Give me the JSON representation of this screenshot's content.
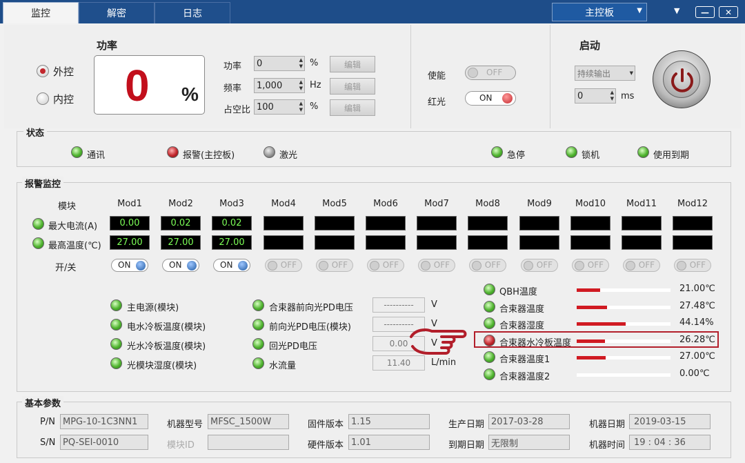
{
  "tabs": [
    {
      "label": "监控"
    },
    {
      "label": "解密"
    },
    {
      "label": "日志"
    }
  ],
  "board_select": "主控板",
  "control": {
    "external": "外控",
    "internal": "内控",
    "selected": "external"
  },
  "power": {
    "title": "功率",
    "value": "0",
    "unit": "%"
  },
  "params": [
    {
      "label": "功率",
      "value": "0",
      "unit": "%",
      "edit": "编辑"
    },
    {
      "label": "频率",
      "value": "1,000",
      "unit": "Hz",
      "edit": "编辑"
    },
    {
      "label": "占空比",
      "value": "100",
      "unit": "%",
      "edit": "编辑"
    }
  ],
  "enable": {
    "label": "使能",
    "state": "OFF"
  },
  "redlight": {
    "label": "红光",
    "state": "ON"
  },
  "start": {
    "title": "启动",
    "mode": "持续输出",
    "ms_value": "0",
    "ms_unit": "ms"
  },
  "status": {
    "title": "状态",
    "items": [
      {
        "label": "通讯",
        "color": "green"
      },
      {
        "label": "报警(主控板)",
        "color": "red"
      },
      {
        "label": "激光",
        "color": "gray"
      },
      {
        "label": "急停",
        "color": "green"
      },
      {
        "label": "锁机",
        "color": "green"
      },
      {
        "label": "使用到期",
        "color": "green"
      }
    ]
  },
  "alarm": {
    "title": "报警监控",
    "module_label": "模块",
    "modules": [
      "Mod1",
      "Mod2",
      "Mod3",
      "Mod4",
      "Mod5",
      "Mod6",
      "Mod7",
      "Mod8",
      "Mod9",
      "Mod10",
      "Mod11",
      "Mod12"
    ],
    "max_current_label": "最大电流(A)",
    "max_temp_label": "最高温度(℃)",
    "max_current": [
      "0.00",
      "0.02",
      "0.02",
      "",
      "",
      "",
      "",
      "",
      "",
      "",
      "",
      ""
    ],
    "max_temp": [
      "27.00",
      "27.00",
      "27.00",
      "",
      "",
      "",
      "",
      "",
      "",
      "",
      "",
      ""
    ],
    "switch_label": "开/关",
    "switches": [
      "ON",
      "ON",
      "ON",
      "OFF",
      "OFF",
      "OFF",
      "OFF",
      "OFF",
      "OFF",
      "OFF",
      "OFF",
      "OFF"
    ]
  },
  "checks_left": [
    "主电源(模块)",
    "电水冷板温度(模块)",
    "光水冷板温度(模块)",
    "光模块湿度(模块)"
  ],
  "checks_mid": [
    {
      "label": "合束器前向光PD电压",
      "value": "----------",
      "unit": "V"
    },
    {
      "label": "前向光PD电压(模块)",
      "value": "----------",
      "unit": "V"
    },
    {
      "label": "回光PD电压",
      "value": "0.00",
      "unit": "V"
    },
    {
      "label": "水流量",
      "value": "11.40",
      "unit": "L/min"
    }
  ],
  "sensors": [
    {
      "label": "QBH温度",
      "value": "21.00℃",
      "level": 0.25,
      "color": "green"
    },
    {
      "label": "合束器温度",
      "value": "27.48℃",
      "level": 0.32,
      "color": "green"
    },
    {
      "label": "合束器湿度",
      "value": "44.14%",
      "level": 0.52,
      "color": "green"
    },
    {
      "label": "合束器水冷板温度",
      "value": "26.28℃",
      "level": 0.3,
      "color": "red"
    },
    {
      "label": "合束器温度1",
      "value": "27.00℃",
      "level": 0.31,
      "color": "green"
    },
    {
      "label": "合束器温度2",
      "value": "0.00℃",
      "level": 0.0,
      "color": "green"
    }
  ],
  "basic": {
    "title": "基本参数",
    "pn_label": "P/N",
    "pn": "MPG-10-1C3NN1",
    "sn_label": "S/N",
    "sn": "PQ-SEI-0010",
    "model_label": "机器型号",
    "model": "MFSC_1500W",
    "module_id_label": "模块ID",
    "module_id": "",
    "fw_label": "固件版本",
    "fw": "1.15",
    "hw_label": "硬件版本",
    "hw": "1.01",
    "prod_date_label": "生产日期",
    "prod_date": "2017-03-28",
    "exp_date_label": "到期日期",
    "exp_date": "无限制",
    "machine_date_label": "机器日期",
    "machine_date": "2019-03-15",
    "machine_time_label": "机器时间",
    "machine_time": "19 : 04 : 36"
  },
  "colors": {
    "titlebar": "#1e4d89",
    "alarm_red": "#c20f1c",
    "led_green": "#4fb32f",
    "bar_red": "#d01a22"
  }
}
